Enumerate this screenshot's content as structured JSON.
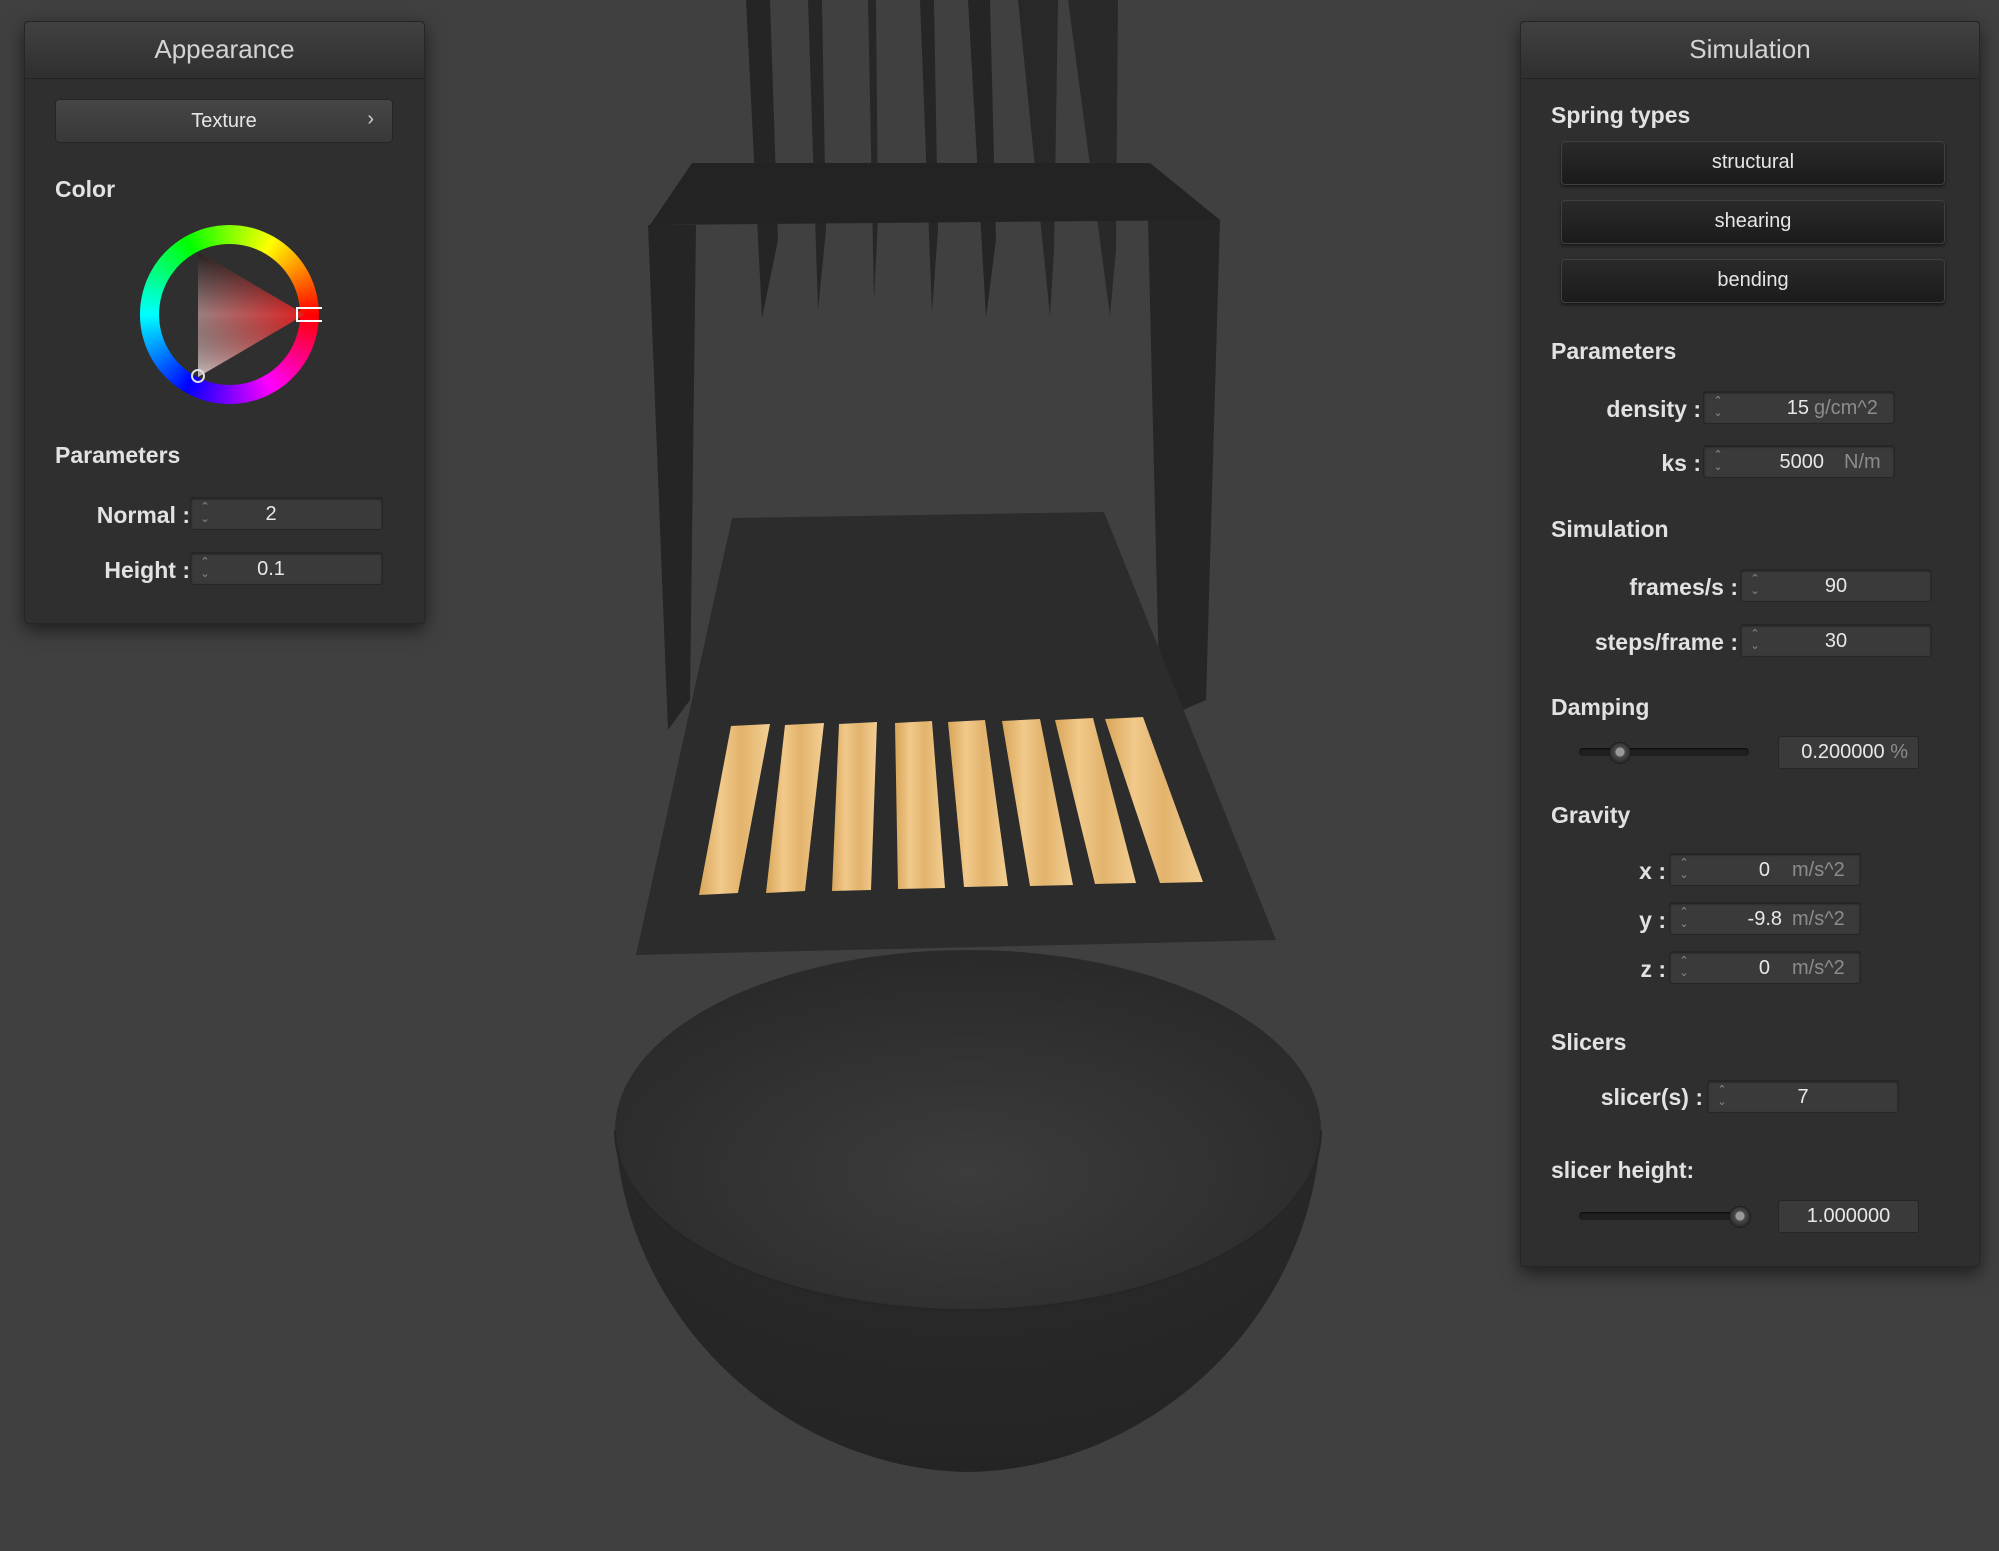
{
  "colors": {
    "background": "#404040",
    "panel": "#2f2f2f",
    "selected_color": "#e02020"
  },
  "appearance": {
    "title": "Appearance",
    "texture_button": "Texture",
    "texture_arrow": "›",
    "color_label": "Color",
    "parameters_label": "Parameters",
    "normal": {
      "label": "Normal :",
      "value": "2"
    },
    "height": {
      "label": "Height :",
      "value": "0.1"
    }
  },
  "simulation": {
    "title": "Simulation",
    "spring_types_label": "Spring types",
    "spring_types": [
      "structural",
      "shearing",
      "bending"
    ],
    "parameters_label": "Parameters",
    "density": {
      "label": "density :",
      "value": "15",
      "unit": "g/cm^2"
    },
    "ks": {
      "label": "ks :",
      "value": "5000",
      "unit": "N/m"
    },
    "simulation_label": "Simulation",
    "fps": {
      "label": "frames/s :",
      "value": "90"
    },
    "steps": {
      "label": "steps/frame :",
      "value": "30"
    },
    "damping_label": "Damping",
    "damping": {
      "value": "0.200000",
      "unit": "%",
      "slider_fraction": 0.2
    },
    "gravity_label": "Gravity",
    "gravity": [
      {
        "label": "x :",
        "value": "0",
        "unit": "m/s^2"
      },
      {
        "label": "y :",
        "value": "-9.8",
        "unit": "m/s^2"
      },
      {
        "label": "z :",
        "value": "0",
        "unit": "m/s^2"
      }
    ],
    "slicers_label": "Slicers",
    "slicers": {
      "label": "slicer(s) :",
      "value": "7"
    },
    "slicer_height_label": "slicer height:",
    "slicer_height": {
      "value": "1.000000",
      "slider_fraction": 1.0
    }
  },
  "scene": {
    "slices": 8
  }
}
